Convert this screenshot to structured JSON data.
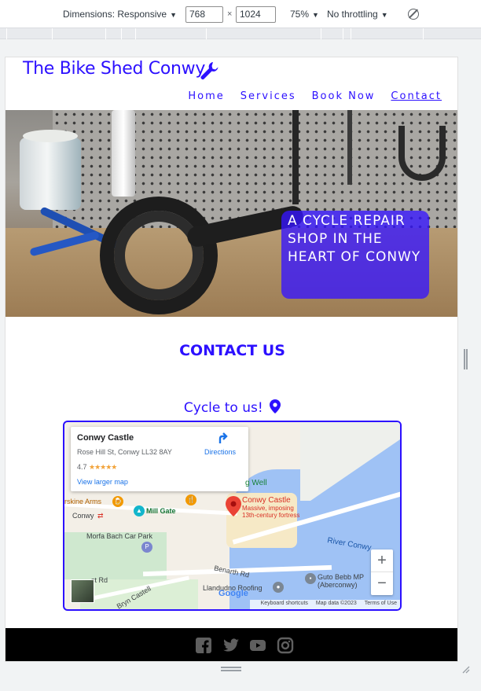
{
  "devtools": {
    "dimensions_label": "Dimensions: Responsive",
    "width_value": "768",
    "times": "×",
    "height_value": "1024",
    "zoom": "75%",
    "throttling": "No throttling"
  },
  "site": {
    "logo": "The Bike Shed Conwy",
    "logo_icon": "wrench-icon",
    "brand_color": "#2c10ff",
    "nav": [
      "Home",
      "Services",
      "Book Now",
      "Contact"
    ],
    "active_nav": "Contact",
    "hero_text": "A CYCLE REPAIR SHOP IN THE HEART OF CONWY",
    "contact_title": "CONTACT US",
    "cycle_text": "Cycle to us!"
  },
  "map": {
    "place_name": "Conwy Castle",
    "address": "Rose Hill St, Conwy LL32 8AY",
    "rating": "4.7",
    "stars": "★★★★★",
    "view_larger": "View larger map",
    "directions": "Directions",
    "labels": {
      "well": "g Well",
      "erskine": "rskine Arms",
      "conwy": "Conwy",
      "mill_gate": "Mill Gate",
      "castle": "Conwy Castle",
      "castle_desc": "Massive, imposing",
      "castle_desc2": "13th-century fortress",
      "morfa": "Morfa Bach Car Park",
      "river": "River Conwy",
      "benarth": "Benarth Rd",
      "llandudno": "Llandudno Roofing",
      "guto": "Guto Bebb MP",
      "aberconwy": "(Aberconwy)",
      "st_rd": "st Rd",
      "bryn": "Bryn Castell",
      "google": "Google"
    },
    "zoom_in": "+",
    "zoom_out": "−",
    "attribution": [
      "Keyboard shortcuts",
      "Map data ©2023",
      "Terms of Use"
    ]
  },
  "footer": {
    "social": [
      "facebook-icon",
      "twitter-icon",
      "youtube-icon",
      "instagram-icon"
    ]
  }
}
